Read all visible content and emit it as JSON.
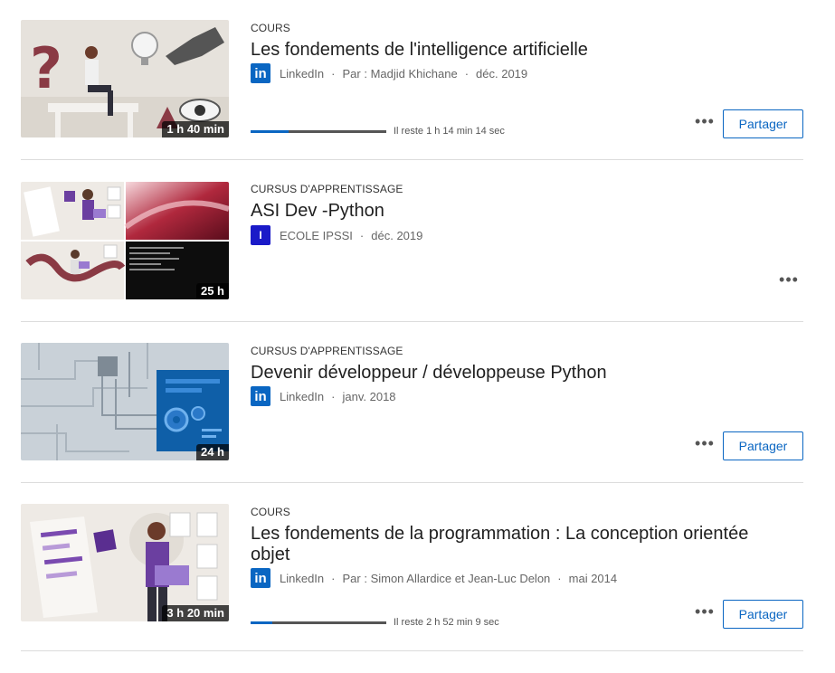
{
  "items": [
    {
      "type": "COURS",
      "title": "Les fondements de l'intelligence artificielle",
      "logo_text": "in",
      "provider": "LinkedIn",
      "author": "Par : Madjid Khichane",
      "date": "déc. 2019",
      "duration": "1 h 40 min",
      "progress": 0.28,
      "remaining": "Il reste 1 h 14 min 14 sec",
      "share_label": "Partager",
      "more_label": "•••"
    },
    {
      "type": "CURSUS D'APPRENTISSAGE",
      "title": "ASI Dev -Python",
      "logo_text": "I",
      "provider": "ECOLE IPSSI",
      "date": "déc. 2019",
      "duration": "25 h",
      "more_label": "•••"
    },
    {
      "type": "CURSUS D'APPRENTISSAGE",
      "title": "Devenir développeur / développeuse Python",
      "logo_text": "in",
      "provider": "LinkedIn",
      "date": "janv. 2018",
      "duration": "24 h",
      "share_label": "Partager",
      "more_label": "•••"
    },
    {
      "type": "COURS",
      "title": "Les fondements de la programmation : La conception orientée objet",
      "logo_text": "in",
      "provider": "LinkedIn",
      "author": "Par : Simon Allardice et Jean-Luc Delon",
      "date": "mai 2014",
      "duration": "3 h 20 min",
      "progress": 0.16,
      "remaining": "Il reste 2 h 52 min 9 sec",
      "share_label": "Partager",
      "more_label": "•••"
    }
  ],
  "colors": {
    "accent": "#0a66c2",
    "ipssi": "#1a1ac8",
    "text": "#1f1f1f",
    "muted": "#666666"
  }
}
